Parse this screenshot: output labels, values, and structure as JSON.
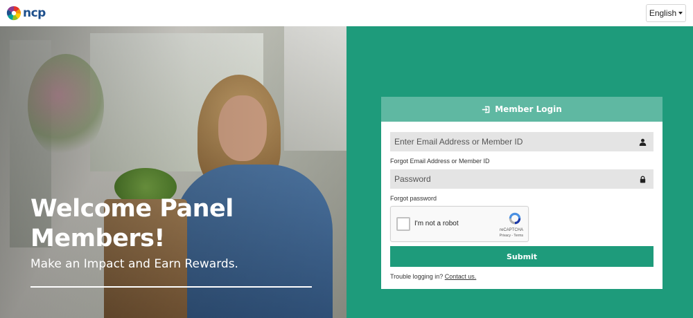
{
  "header": {
    "logo_text": "ncp",
    "language": {
      "selected": "English",
      "icon": "caret-down-icon"
    }
  },
  "hero": {
    "title": "Welcome Panel Members!",
    "subtitle": "Make an Impact and Earn Rewards."
  },
  "login": {
    "heading": "Member Login",
    "heading_icon": "sign-in-icon",
    "email_placeholder": "Enter Email Address or Member ID",
    "email_icon": "user-icon",
    "forgot_email": "Forgot Email Address or Member ID",
    "password_placeholder": "Password",
    "password_icon": "lock-icon",
    "forgot_password": "Forgot password",
    "captcha": {
      "label": "I'm not a robot",
      "brand": "reCAPTCHA",
      "privacy": "Privacy",
      "separator": " - ",
      "terms": "Terms"
    },
    "submit_label": "Submit",
    "trouble_text": "Trouble logging in?",
    "contact_link": "Contact us."
  },
  "colors": {
    "accent": "#1e9b7b",
    "card_header": "#5fb8a2",
    "logo_blue": "#1d4f8c"
  }
}
